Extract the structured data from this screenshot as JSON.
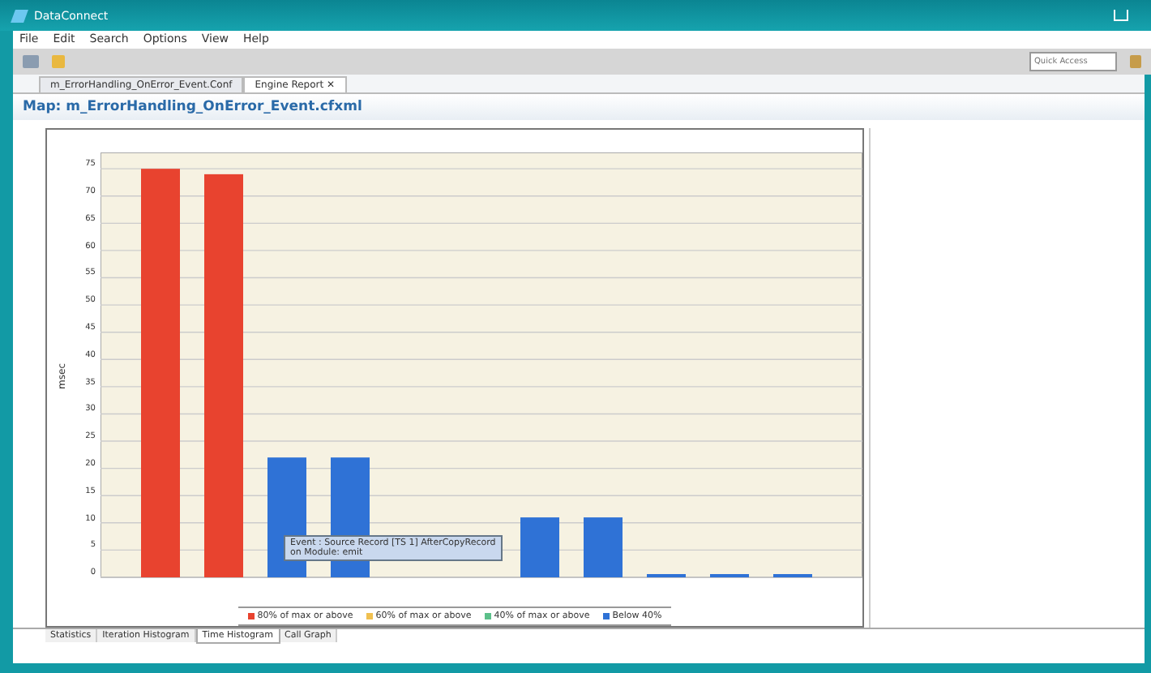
{
  "window": {
    "title": "DataConnect"
  },
  "menu": [
    "File",
    "Edit",
    "Search",
    "Options",
    "View",
    "Help"
  ],
  "quick_access": {
    "placeholder": "Quick Access"
  },
  "editor_tabs": [
    {
      "label": "m_ErrorHandling_OnError_Event.Conf",
      "selected": false
    },
    {
      "label": "Engine Report",
      "close": "✕",
      "selected": true
    }
  ],
  "map_title": "Map: m_ErrorHandling_OnError_Event.cfxml",
  "chart": {
    "chart_data": {
      "type": "bar",
      "ylabel": "msec",
      "ylim": [
        0,
        78
      ],
      "yticks": [
        0,
        5,
        10,
        15,
        20,
        25,
        30,
        35,
        40,
        45,
        50,
        55,
        60,
        65,
        70,
        75
      ],
      "grid": true,
      "series": [
        {
          "name": "80% of max or above",
          "color": "#e8432f",
          "values": [
            75,
            74,
            null,
            null,
            null,
            null,
            null,
            null,
            null,
            null,
            null
          ]
        },
        {
          "name": "60% of max or above",
          "color": "#f0c050",
          "values": [
            null,
            null,
            null,
            null,
            null,
            null,
            null,
            null,
            null,
            null,
            null
          ]
        },
        {
          "name": "40% of max or above",
          "color": "#5cc08a",
          "values": [
            null,
            null,
            null,
            null,
            null,
            null,
            null,
            null,
            null,
            null,
            null
          ]
        },
        {
          "name": "Below 40%",
          "color": "#2f72d6",
          "values": [
            null,
            null,
            22,
            22,
            null,
            null,
            11,
            11,
            0,
            0,
            0
          ]
        }
      ]
    },
    "tooltip": [
      "Event : Source Record [TS 1] AfterCopyRecord",
      "on Module: emit"
    ]
  },
  "bottom_tabs": [
    {
      "label": "Statistics",
      "selected": false
    },
    {
      "label": "Iteration Histogram",
      "selected": false
    },
    {
      "label": "Time Histogram",
      "selected": true
    },
    {
      "label": "Call Graph",
      "selected": false
    }
  ]
}
